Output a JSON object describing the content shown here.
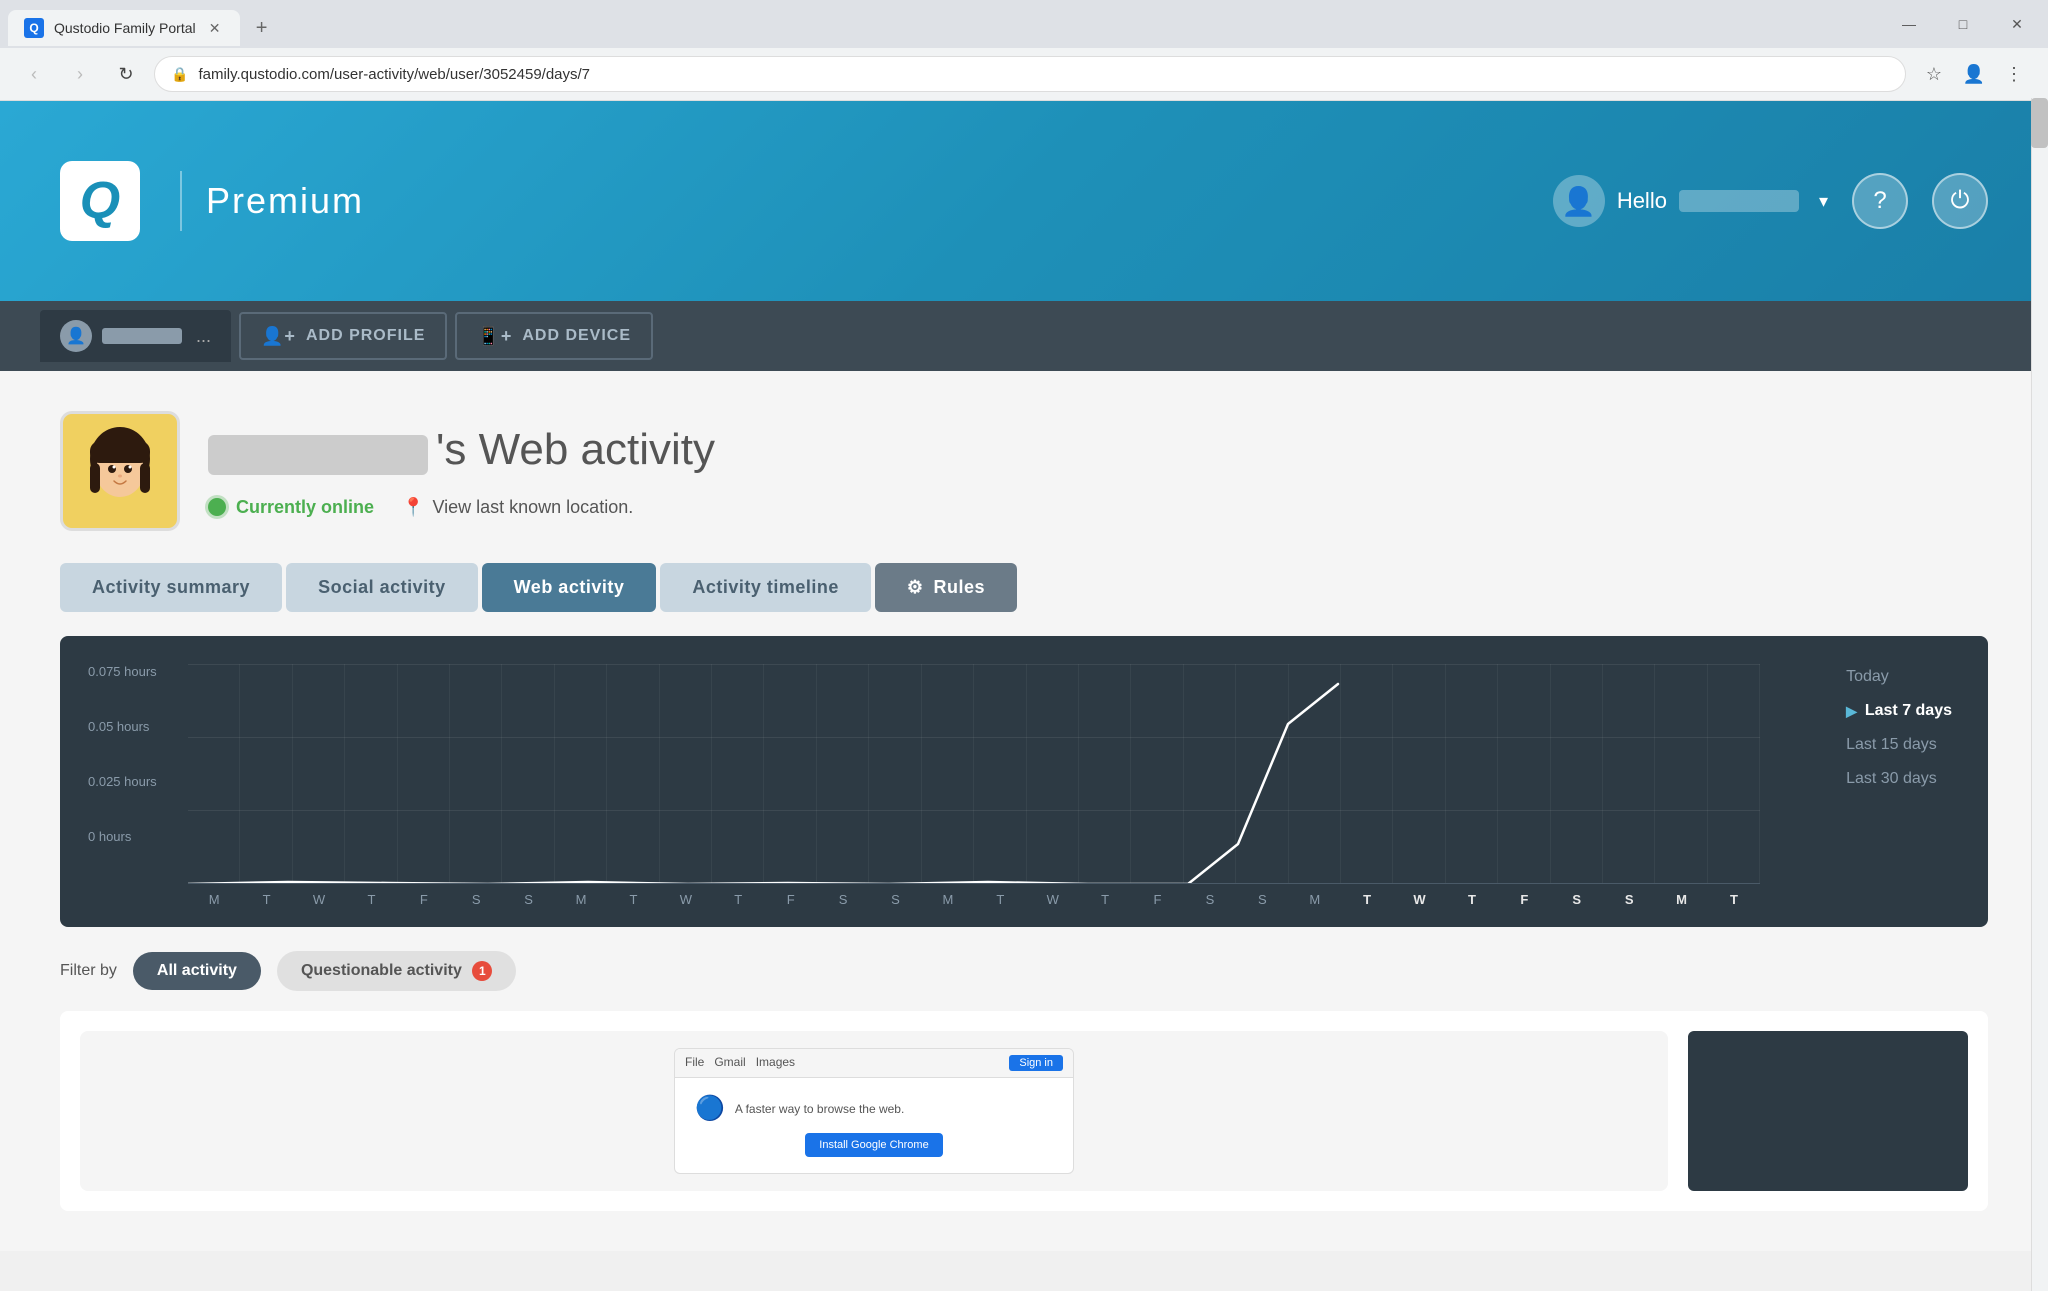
{
  "browser": {
    "tab_title": "Qustodio Family Portal",
    "url": "family.qustodio.com/user-activity/web/user/3052459/days/7",
    "favicon_letter": "Q",
    "new_tab_symbol": "+",
    "nav_back": "‹",
    "nav_forward": "›",
    "nav_reload": "↺",
    "win_minimize": "—",
    "win_maximize": "□",
    "win_close": "✕"
  },
  "header": {
    "logo_letter": "Q",
    "product_name": "Premium",
    "greeting": "Hello",
    "user_name_placeholder": "██████████",
    "help_symbol": "?",
    "power_symbol": "⏻"
  },
  "profile_bar": {
    "add_profile_label": "ADD PROFILE",
    "add_device_label": "ADD DEVICE",
    "profile_dots": "..."
  },
  "page": {
    "user_name_display": "'s Web activity",
    "currently_online": "Currently online",
    "location_link": "View last known location.",
    "tabs": [
      {
        "id": "activity-summary",
        "label": "Activity summary",
        "active": false
      },
      {
        "id": "social-activity",
        "label": "Social activity",
        "active": false
      },
      {
        "id": "web-activity",
        "label": "Web activity",
        "active": true
      },
      {
        "id": "activity-timeline",
        "label": "Activity timeline",
        "active": false
      },
      {
        "id": "rules",
        "label": "Rules",
        "active": false
      }
    ]
  },
  "chart": {
    "y_labels": [
      "0.075 hours",
      "0.05 hours",
      "0.025 hours",
      "0 hours"
    ],
    "x_labels": [
      "M",
      "T",
      "W",
      "T",
      "F",
      "S",
      "S",
      "M",
      "T",
      "W",
      "T",
      "F",
      "S",
      "S",
      "M",
      "T",
      "W",
      "T",
      "F",
      "S",
      "S",
      "M",
      "T",
      "W",
      "T",
      "F",
      "S",
      "S",
      "M",
      "T"
    ],
    "bold_indices": [
      22,
      23,
      24,
      25,
      26,
      27,
      28,
      29
    ],
    "legend": {
      "today": "Today",
      "last7": "Last 7 days",
      "last15": "Last 15 days",
      "last30": "Last 30 days"
    }
  },
  "filter": {
    "label": "Filter by",
    "buttons": [
      {
        "id": "all",
        "label": "All activity",
        "active": true,
        "badge": null
      },
      {
        "id": "questionable",
        "label": "Questionable activity",
        "active": false,
        "badge": "1"
      }
    ]
  },
  "screenshots": {
    "toolbar_items": [
      "File",
      "Gmail",
      "Images",
      "Sign in"
    ],
    "install_text": "A faster way to browse the web.",
    "install_btn": "Install Google Chrome"
  }
}
